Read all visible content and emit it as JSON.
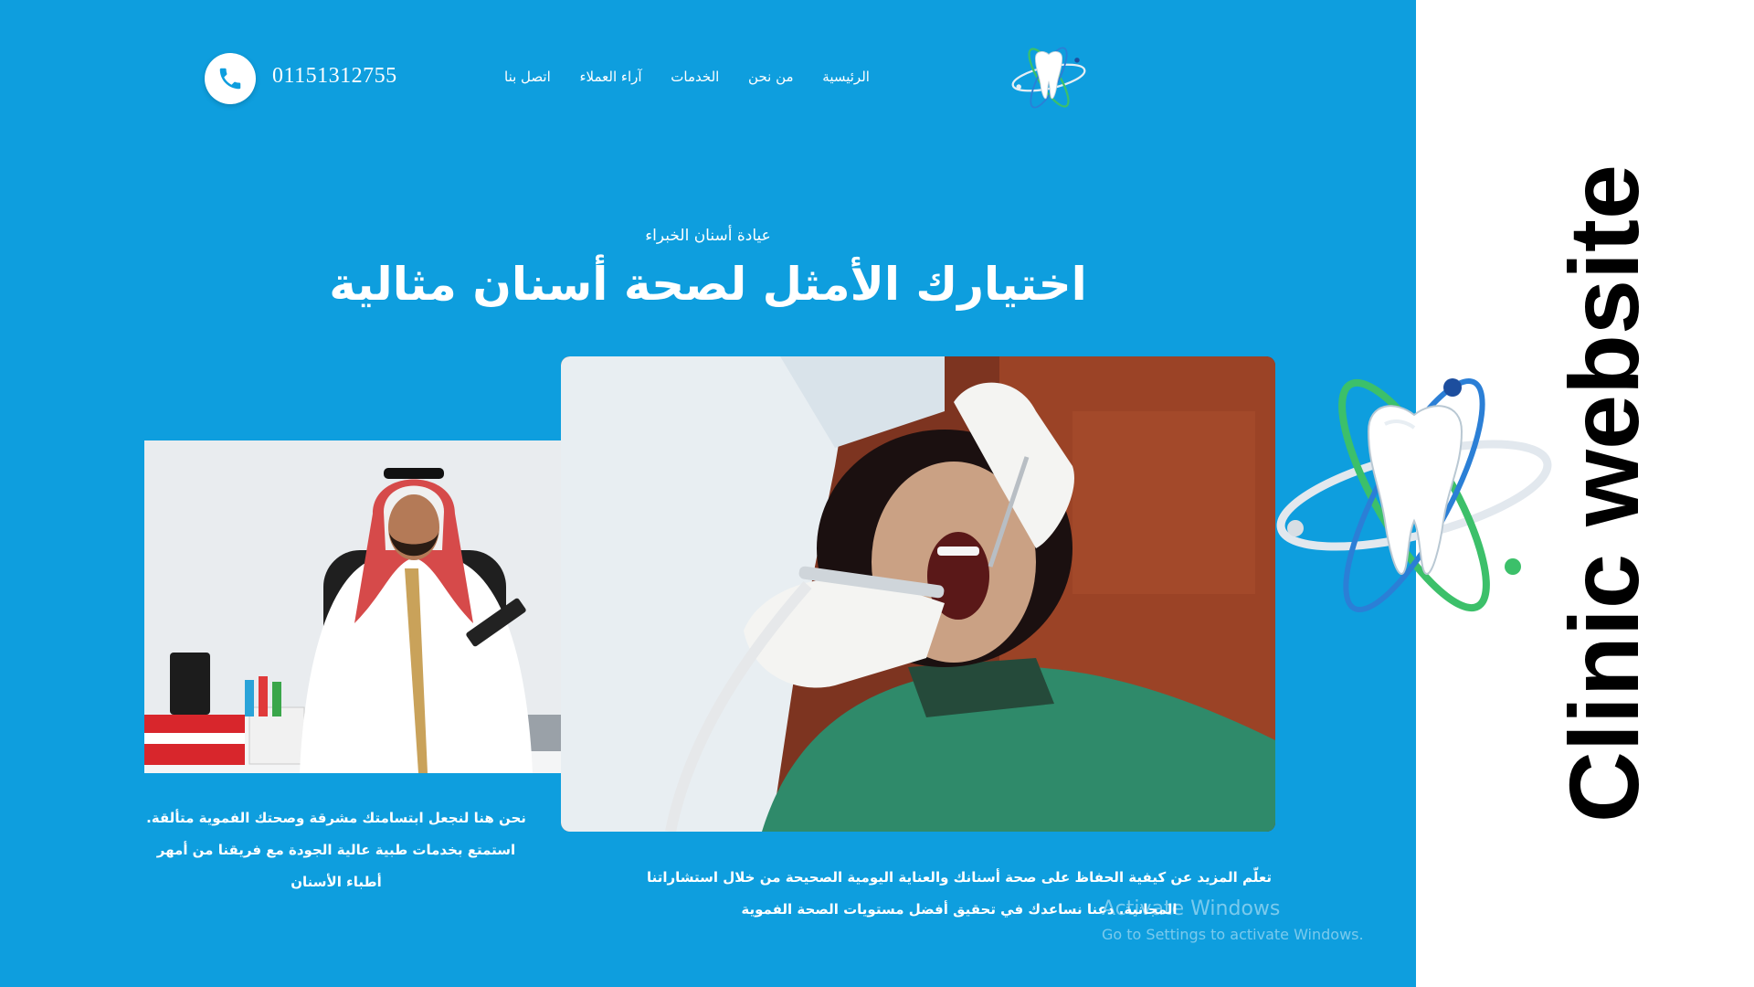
{
  "header": {
    "phone_number": "01151312755",
    "nav": [
      {
        "label": "الرئيسية"
      },
      {
        "label": "من نحن"
      },
      {
        "label": "الخدمات"
      },
      {
        "label": "آراء العملاء"
      },
      {
        "label": "اتصل بنا"
      }
    ],
    "logo_icon": "tooth-atom-logo-icon",
    "phone_icon": "phone-icon"
  },
  "hero": {
    "eyebrow": "عيادة أسنان الخبراء",
    "headline": "اختيارك الأمثل لصحة أسنان مثالية",
    "paragraph_left": "نحن هنا لنجعل ابتسامتك مشرقة وصحتك الفموية متألقة. استمتع بخدمات طبية عالية الجودة مع فريقنا من أمهر أطباء الأسنان",
    "paragraph_right": "تعلّم المزيد عن كيفية الحفاظ على صحة أسنانك والعناية اليومية الصحيحة من خلال استشاراتنا المجانية. دعنا نساعدك في تحقيق أفضل مستويات الصحة الفموية"
  },
  "watermark": {
    "line1": "Activate Windows",
    "line2": "Go to Settings to activate Windows."
  },
  "side_panel": {
    "title": "Clinic website"
  },
  "colors": {
    "hero_background": "#0e9ede",
    "text": "#ffffff",
    "side_background": "#ffffff",
    "side_title": "#000000"
  }
}
